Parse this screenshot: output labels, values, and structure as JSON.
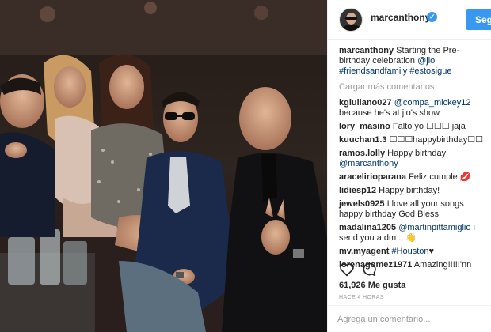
{
  "header": {
    "username": "marcanthony",
    "verified_badge": "✔",
    "follow_label": "Seguir"
  },
  "caption": {
    "username": "marcanthony",
    "text": "Starting the Pre-birthday celebration",
    "mention": "@jlo",
    "hashtags": "#friendsandfamily #estosigue"
  },
  "load_more": "Cargar más comentarios",
  "comments": [
    {
      "user": "kgiuliano027",
      "mention": "@compa_mickey12",
      "text": "because he's at jlo's show"
    },
    {
      "user": "lory_masino",
      "mention": "",
      "text": "Falto yo ☐☐☐ jaja"
    },
    {
      "user": "kuuchan1.3",
      "mention": "",
      "text": "☐☐☐happybirthday☐☐"
    },
    {
      "user": "ramos.lolly",
      "mention": "@marcanthony",
      "text": "Happy birthday"
    },
    {
      "user": "aracelirioparana",
      "mention": "",
      "text": "Feliz cumple 💋"
    },
    {
      "user": "lidiesp12",
      "mention": "",
      "text": "Happy birthday!"
    },
    {
      "user": "jewels0925",
      "mention": "",
      "text": "I love all your songs happy birthday God Bless"
    },
    {
      "user": "madalina1205",
      "mention": "@martinpittamiglio",
      "text": "i send you a dm .. 👋"
    },
    {
      "user": "mv.myagent",
      "mention": "#Houston",
      "text": "♥"
    },
    {
      "user": "lorenagomez1971",
      "mention": "",
      "text": "Amazing!!!!!'nn"
    }
  ],
  "actions": {
    "heart_icon": "heart-icon",
    "comment_icon": "comment-icon",
    "likes_count": "61,926",
    "likes_label": "Me gusta",
    "timestamp": "HACE 4 HORAS"
  },
  "add_comment": {
    "placeholder": "Agrega un comentario..."
  },
  "colors": {
    "accent": "#3897f0",
    "link": "#003569",
    "muted": "#999999",
    "border": "#efefef"
  }
}
